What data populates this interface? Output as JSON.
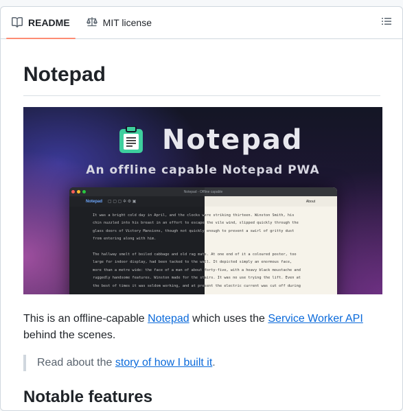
{
  "tabs": [
    {
      "label": "README",
      "icon": "book-icon",
      "active": true
    },
    {
      "label": "MIT license",
      "icon": "law-icon",
      "active": false
    }
  ],
  "outline_icon": "list-unordered-icon",
  "title": "Notepad",
  "hero": {
    "name": "Notepad",
    "subtitle": "An offline capable Notepad PWA",
    "window_title": "Notepad - Offline capable",
    "toolbar_name": "Notepad",
    "toolbar_about": "About",
    "paragraphs": [
      [
        "It was a bright cold day in April, and the clocks were striking thirteen. Winston Smith, his",
        "chin nuzzled into his breast in an effort to escape the vile wind, slipped quickly through the",
        "glass doors of Victory Mansions, though not quickly enough to prevent a swirl of gritty dust",
        "from entering along with him."
      ],
      [
        "The hallway smelt of boiled cabbage and old rag mats. At one end of it a coloured poster, too",
        "large for indoor display, had been tacked to the wall. It depicted simply an enormous face,",
        "more than a metre wide: the face of a man of about forty-five, with a heavy black moustache and",
        "ruggedly handsome features. Winston made for the stairs. It was no use trying the lift. Even at",
        "the best of times it was seldom working, and at present the electric current was cut off during"
      ]
    ],
    "colors": {
      "dot_red": "#ff5f57",
      "dot_yellow": "#febc2e",
      "dot_green": "#28c840",
      "logo": "#3ecf9e"
    }
  },
  "intro": {
    "before": "This is an offline-capable ",
    "link1": "Notepad",
    "middle": " which uses the ",
    "link2": "Service Worker API",
    "after": " behind the scenes."
  },
  "quote": {
    "before": "Read about the ",
    "link": "story of how I built it",
    "after": "."
  },
  "features_heading": "Notable features",
  "colors": {
    "accent": "#0969da",
    "tab_underline": "#fd8c73",
    "border": "#d0d7de"
  }
}
